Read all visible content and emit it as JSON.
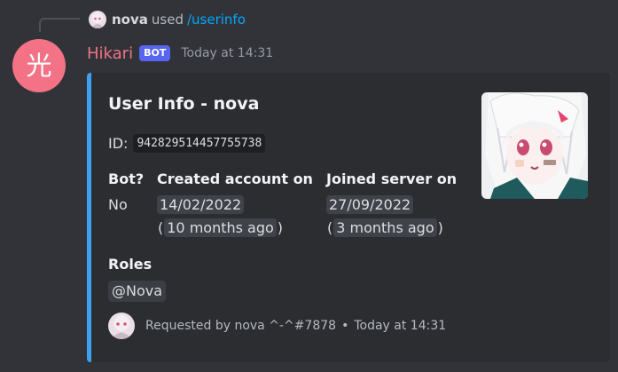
{
  "reply": {
    "username": "nova",
    "used_text": "used",
    "command": "/userinfo"
  },
  "bot": {
    "avatar_glyph": "光",
    "name": "Hikari",
    "tag": "BOT",
    "timestamp": "Today at 14:31"
  },
  "embed": {
    "accent_color": "#3ba1f0",
    "title": "User Info - nova",
    "id_label": "ID:",
    "id_value": "942829514457755738",
    "fields": [
      {
        "name": "Bot?",
        "value": "No"
      },
      {
        "name": "Created account on",
        "value": "14/02/2022",
        "relative_open": "(",
        "relative": "10 months ago",
        "relative_close": ")"
      },
      {
        "name": "Joined server on",
        "value": "27/09/2022",
        "relative_open": "(",
        "relative": "3 months ago",
        "relative_close": ")"
      }
    ],
    "roles_name": "Roles",
    "role": "@Nova",
    "footer": {
      "requested_by": "Requested by nova ^-^#7878",
      "separator": "•",
      "timestamp": "Today at 14:31"
    }
  }
}
